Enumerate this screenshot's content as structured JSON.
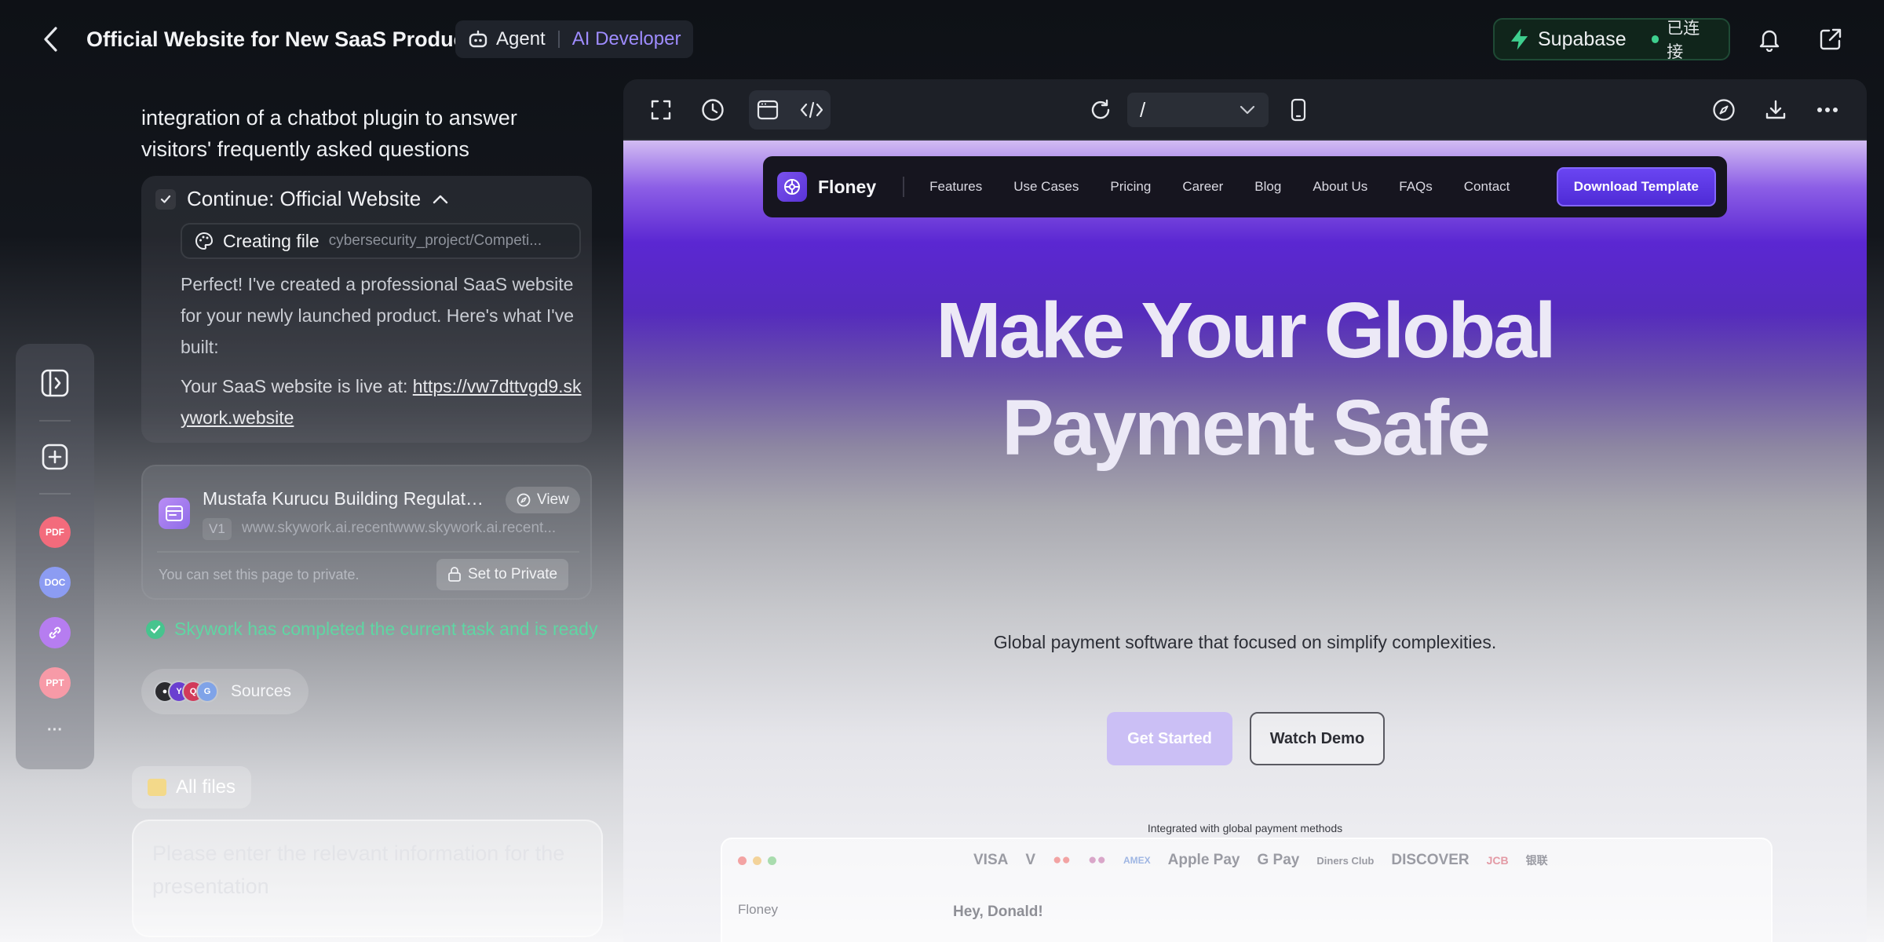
{
  "header": {
    "project_title": "Official Website for New SaaS Product",
    "mode_agent": "Agent",
    "mode_developer": "AI Developer",
    "supabase_name": "Supabase",
    "supabase_status": "已连接"
  },
  "rail": {
    "files": [
      {
        "label": "PDF",
        "color": "#f36b7c"
      },
      {
        "label": "DOC",
        "color": "#8c9cf2"
      },
      {
        "label": "",
        "color": "#b67df0"
      },
      {
        "label": "PPT",
        "color": "#f79aa7"
      }
    ],
    "more": "···"
  },
  "chat": {
    "message_fragment": "integration of a chatbot plugin to answer visitors' frequently asked questions",
    "task_title": "Continue: Official Website",
    "file_action": "Creating file",
    "file_path": "cybersecurity_project/Competi...",
    "reply": "Perfect! I've created a professional SaaS website for your newly launched product. Here's what I've built:",
    "live_prefix": "Your SaaS website is live at: ",
    "live_url": "https://vw7dttvgd9.skywork.website",
    "site_card": {
      "name": "Mustafa Kurucu Building Regulatio...",
      "view_label": "View",
      "version": "V1",
      "url": "www.skywork.ai.recentwww.skywork.ai.recent...",
      "private_hint": "You can set this page to private.",
      "private_button": "Set to Private"
    },
    "completed": "Skywork has completed the current task and is ready",
    "sources_label": "Sources",
    "all_files_label": "All files",
    "input_placeholder": "Please enter the relevant information for the presentation"
  },
  "preview": {
    "route": "/",
    "site": {
      "brand": "Floney",
      "nav": [
        "Features",
        "Use Cases",
        "Pricing",
        "Career",
        "Blog",
        "About Us",
        "FAQs",
        "Contact"
      ],
      "cta": "Download Template",
      "hero_line1": "Make Your Global",
      "hero_line2": "Payment Safe",
      "subtitle": "Global payment software that focused on simplify complexities.",
      "primary_button": "Get Started",
      "secondary_button": "Watch Demo",
      "integrated_text": "Integrated with global payment methods",
      "payment_methods": [
        "VISA",
        "V",
        "●●",
        "●●",
        "AMEX",
        "Apple Pay",
        "G Pay",
        "Diners Club",
        "DISCOVER",
        "JCB",
        "银联"
      ],
      "mock_brand": "Floney",
      "mock_greeting": "Hey, Donald!"
    }
  },
  "colors": {
    "accent": "#5b27d2",
    "success": "#47c48e",
    "developer": "#9f8cff"
  }
}
